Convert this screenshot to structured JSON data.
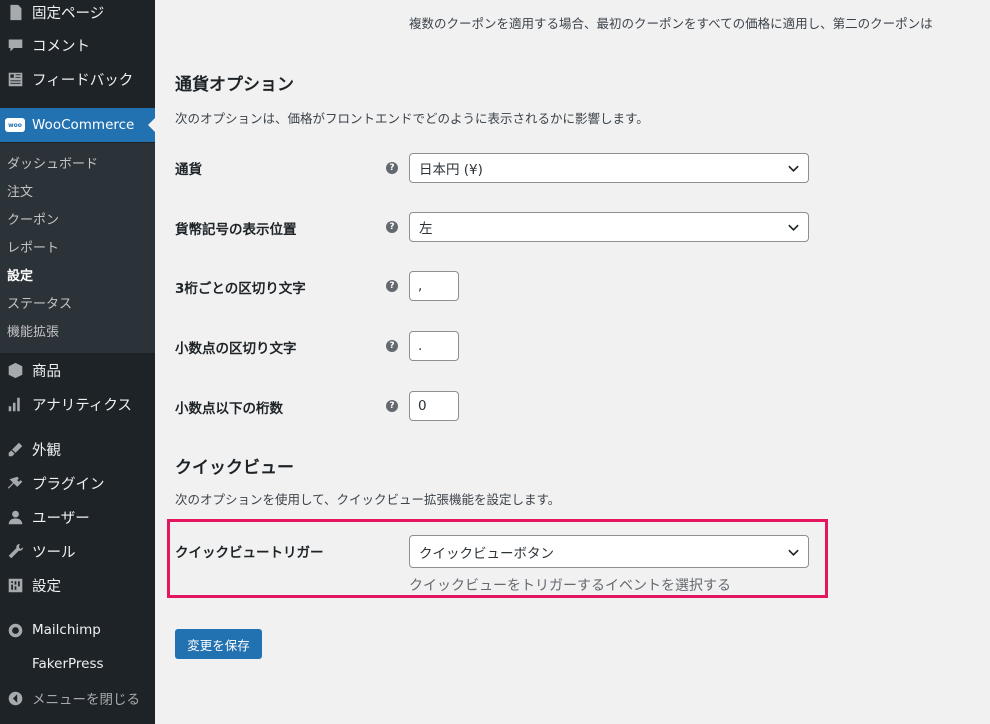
{
  "sidebar": {
    "top_items": [
      {
        "label": "固定ページ",
        "icon": "page-icon"
      },
      {
        "label": "コメント",
        "icon": "comment-icon"
      },
      {
        "label": "フィードバック",
        "icon": "feedback-icon"
      }
    ],
    "woocommerce": {
      "label": "WooCommerce",
      "badge": "woo",
      "icon": "woocommerce-icon"
    },
    "submenu": [
      {
        "label": "ダッシュボード"
      },
      {
        "label": "注文"
      },
      {
        "label": "クーポン"
      },
      {
        "label": "レポート"
      },
      {
        "label": "設定",
        "current": true
      },
      {
        "label": "ステータス"
      },
      {
        "label": "機能拡張"
      }
    ],
    "bottom_items": [
      {
        "label": "商品",
        "icon": "product-icon"
      },
      {
        "label": "アナリティクス",
        "icon": "analytics-icon"
      },
      {
        "label": "外観",
        "icon": "appearance-icon"
      },
      {
        "label": "プラグイン",
        "icon": "plugin-icon"
      },
      {
        "label": "ユーザー",
        "icon": "user-icon"
      },
      {
        "label": "ツール",
        "icon": "tool-icon"
      },
      {
        "label": "設定",
        "icon": "settings-icon"
      },
      {
        "label": "Mailchimp",
        "icon": "mailchimp-icon"
      },
      {
        "label": "FakerPress",
        "icon": ""
      },
      {
        "label": "メニューを閉じる",
        "icon": "collapse-icon"
      }
    ]
  },
  "content": {
    "top_desc": "複数のクーポンを適用する場合、最初のクーポンをすべての価格に適用し、第二のクーポンは",
    "currency_section": {
      "title": "通貨オプション",
      "description": "次のオプションは、価格がフロントエンドでどのように表示されるかに影響します。",
      "fields": {
        "currency": {
          "label": "通貨",
          "value": "日本円 (¥)"
        },
        "position": {
          "label": "貨幣記号の表示位置",
          "value": "左"
        },
        "thousand_sep": {
          "label": "3桁ごとの区切り文字",
          "value": ","
        },
        "decimal_sep": {
          "label": "小数点の区切り文字",
          "value": "."
        },
        "num_decimals": {
          "label": "小数点以下の桁数",
          "value": "0"
        }
      }
    },
    "quickview_section": {
      "title": "クイックビュー",
      "description": "次のオプションを使用して、クイックビュー拡張機能を設定します。",
      "trigger": {
        "label": "クイックビュートリガー",
        "value": "クイックビューボタン",
        "help_text": "クイックビューをトリガーするイベントを選択する"
      }
    },
    "save_button": "変更を保存"
  },
  "colors": {
    "sidebar_bg": "#1d2327",
    "submenu_bg": "#2c3338",
    "accent": "#2271b1",
    "highlight": "#e4165f"
  }
}
